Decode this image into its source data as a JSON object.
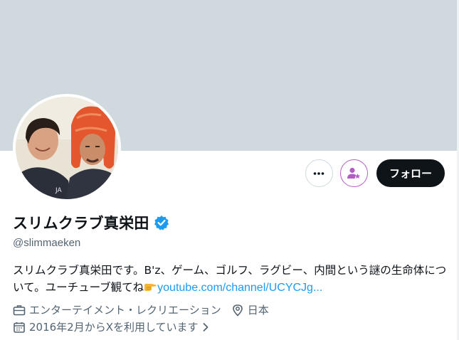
{
  "profile": {
    "display_name": "スリムクラブ真栄田",
    "handle": "@slimmaeken",
    "bio_text": "スリムクラブ真栄田です。B'z、ゲーム、ゴルフ、ラグビー、内間という謎の生命体について。ユーチューブ観てね",
    "bio_emoji": "pointing-right-hand-emoji",
    "bio_link": "youtube.com/channel/UCYCJg...",
    "category": "エンターテイメント・レクリエーション",
    "location": "日本",
    "joined": "2016年2月からXを利用しています"
  },
  "actions": {
    "more_icon": "more-dots-icon",
    "subscribe_icon": "person-star-icon",
    "follow_label": "フォロー"
  },
  "icons": {
    "verified": "verified-badge-icon",
    "category": "briefcase-icon",
    "location": "location-pin-icon",
    "joined": "calendar-icon"
  },
  "colors": {
    "banner": "#cfd9de",
    "link": "#1d9bf0",
    "verified": "#1d9bf0",
    "follow_bg": "#0f1419",
    "subscribe_accent": "#b45cc6",
    "secondary_text": "#536471"
  }
}
